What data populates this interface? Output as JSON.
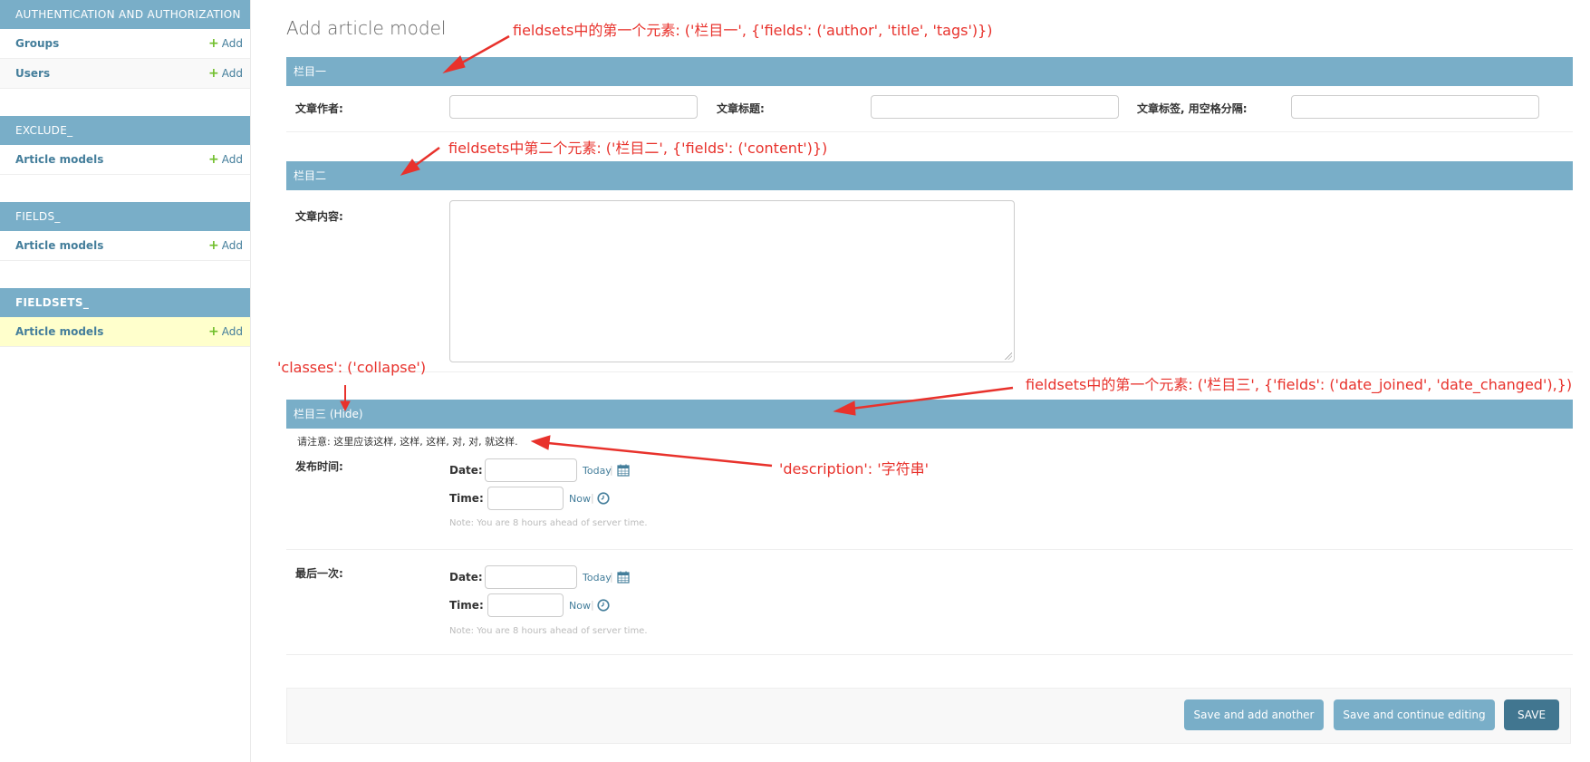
{
  "sidebar": {
    "modules": [
      {
        "caption": "AUTHENTICATION AND AUTHORIZATION",
        "rows": [
          {
            "label": "Groups",
            "add": "Add"
          },
          {
            "label": "Users",
            "add": "Add"
          }
        ]
      },
      {
        "caption": "EXCLUDE_",
        "rows": [
          {
            "label": "Article models",
            "add": "Add"
          }
        ]
      },
      {
        "caption": "FIELDS_",
        "rows": [
          {
            "label": "Article models",
            "add": "Add"
          }
        ]
      },
      {
        "caption": "FIELDSETS_",
        "rows": [
          {
            "label": "Article models",
            "add": "Add"
          }
        ]
      }
    ]
  },
  "main": {
    "title": "Add article model",
    "fieldset1": {
      "caption": "栏目一",
      "author_label": "文章作者:",
      "title_label": "文章标题:",
      "tags_label": "文章标签, 用空格分隔:"
    },
    "fieldset2": {
      "caption": "栏目二",
      "content_label": "文章内容:"
    },
    "fieldset3": {
      "caption": "栏目三",
      "toggle": "(Hide)",
      "description": "请注意: 这里应该这样, 这样, 这样, 对, 对, 就这样.",
      "date_joined_label": "发布时间:",
      "date_changed_label": "最后一次:",
      "date_label": "Date:",
      "time_label": "Time:",
      "today": "Today",
      "now": "Now",
      "separator": "|",
      "note": "Note: You are 8 hours ahead of server time."
    }
  },
  "submit": {
    "save_add_another": "Save and add another",
    "save_continue": "Save and continue editing",
    "save": "SAVE"
  },
  "annotations": {
    "a1": "fieldsets中的第一个元素:  ('栏目一', {'fields': ('author', 'title', 'tags')})",
    "a2": "fieldsets中第二个元素:  ('栏目二', {'fields': ('content')})",
    "a3": "'classes': ('collapse')",
    "a4": "fieldsets中的第一个元素:  ('栏目三', {'fields': ('date_joined', 'date_changed'),})",
    "a5": "'description': '字符串'"
  },
  "colors": {
    "header_blue": "#79aec8",
    "link_blue": "#447e9b",
    "add_green": "#70bf2b",
    "selected_row": "#ffffcc",
    "save_button": "#417690",
    "annotation_red": "#e8322c"
  }
}
